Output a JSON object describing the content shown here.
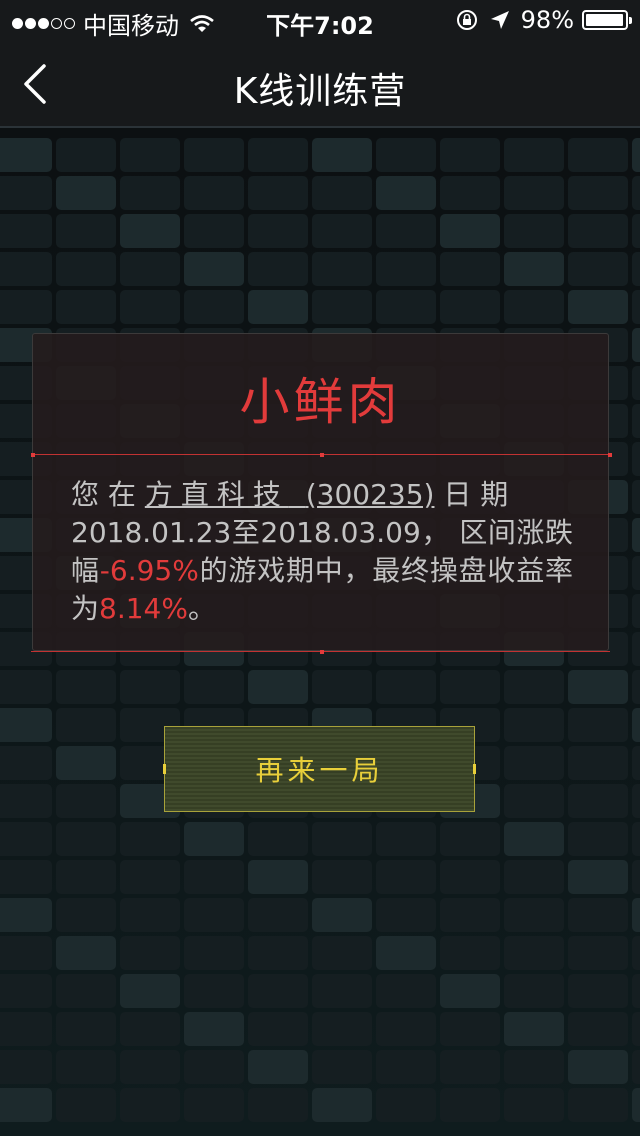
{
  "status_bar": {
    "carrier": "中国移动",
    "time": "下午7:02",
    "battery": "98%",
    "battery_level": 0.98,
    "signal_strength": 3
  },
  "nav": {
    "title": "K线训练营",
    "back_icon": "chevron-left-icon"
  },
  "result": {
    "title": "小鲜肉",
    "text_intro": "您 在 ",
    "stock_name": "方直科技",
    "stock_code": "(300235)",
    "text_date_label": " 日 期",
    "start_date": "2018.01.23",
    "to_label": "至",
    "end_date": "2018.03.09",
    "text_range_label": "， 区间涨跌幅",
    "change_pct": "-6.95%",
    "text_final_label": "的游戏期中，最终操盘收益率为",
    "return_pct": "8.14%",
    "text_end": "。"
  },
  "actions": {
    "replay_label": "再来一局"
  },
  "colors": {
    "accent_red": "#e23b3b",
    "accent_yellow": "#e8cf3a",
    "background": "#0c1114"
  }
}
